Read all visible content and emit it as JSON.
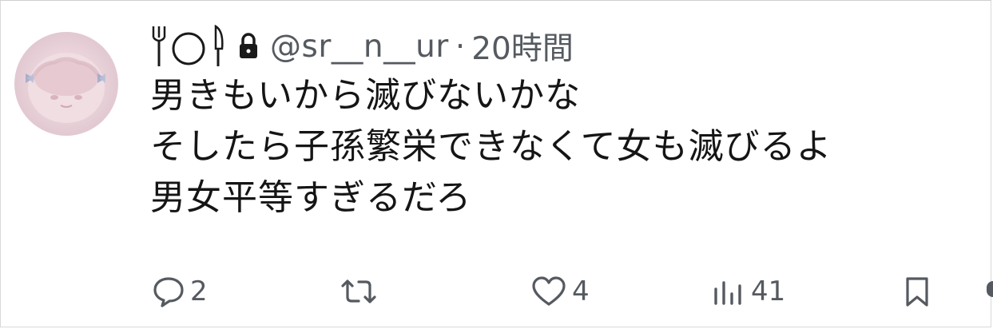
{
  "post": {
    "handle": "@sr__n__ur",
    "separator": "·",
    "time": "20時間",
    "lines": [
      "男きもいから滅びないかな",
      "そしたら子孫繁栄できなくて女も滅びるよ",
      "男女平等すぎるだろ"
    ]
  },
  "actions": {
    "reply_count": "2",
    "retweet_count": "",
    "like_count": "4",
    "views_count": "41"
  },
  "icons": {
    "display_name": [
      "fork-icon",
      "plate-icon",
      "knife-icon"
    ],
    "lock": "lock-icon",
    "reply": "speech-bubble-icon",
    "retweet": "retweet-icon",
    "like": "heart-icon",
    "views": "bar-chart-icon",
    "bookmark": "bookmark-icon"
  },
  "colors": {
    "text": "#151515",
    "muted": "#555a60",
    "avatar": "#ead3da"
  }
}
